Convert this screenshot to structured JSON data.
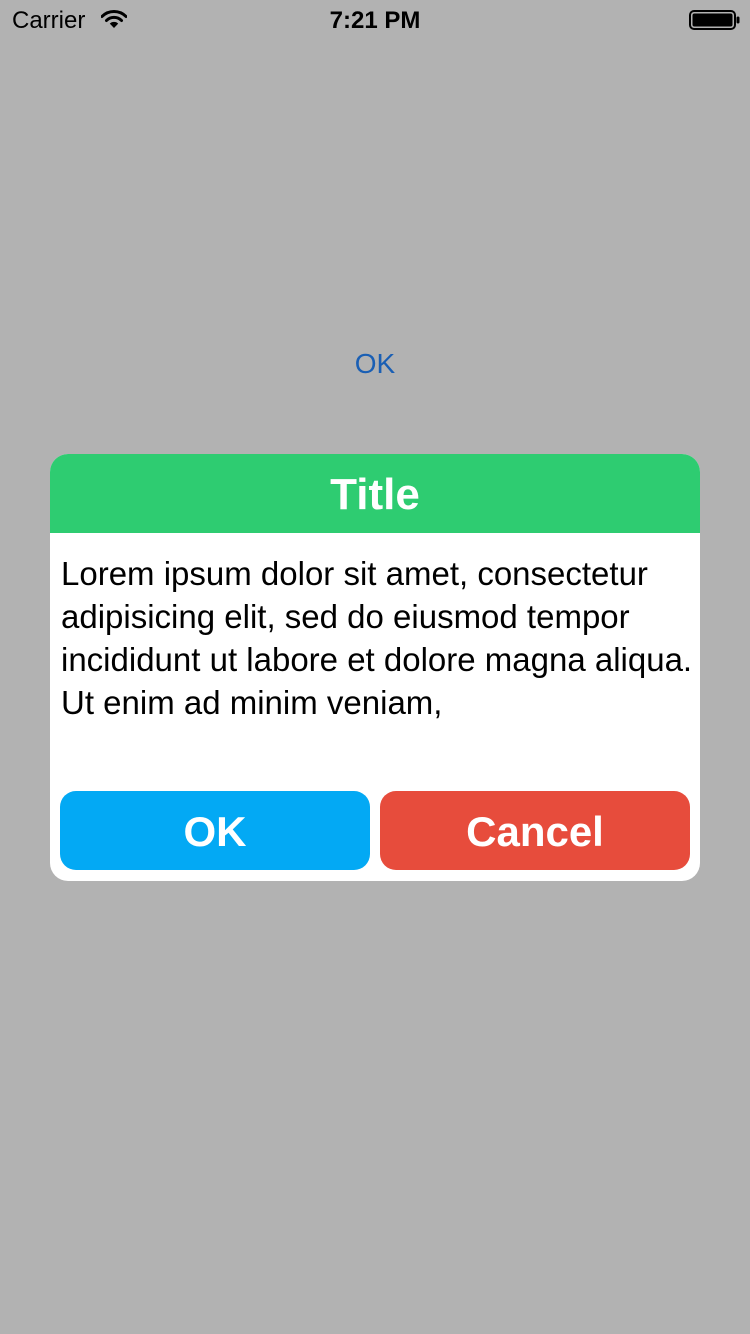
{
  "status_bar": {
    "carrier": "Carrier",
    "time": "7:21 PM",
    "wifi_icon": "wifi-icon",
    "battery_icon": "battery-icon"
  },
  "background": {
    "ok_label": "OK",
    "color": "#b2b2b2",
    "link_color": "#1a5fb4"
  },
  "dialog": {
    "title": "Title",
    "message": "Lorem ipsum dolor sit amet, consectetur adipisicing elit, sed do eiusmod tempor incididunt ut labore et dolore magna aliqua. Ut enim ad minim veniam,",
    "ok_label": "OK",
    "cancel_label": "Cancel",
    "header_color": "#2ecc71",
    "ok_color": "#03a9f4",
    "cancel_color": "#e74c3c"
  }
}
